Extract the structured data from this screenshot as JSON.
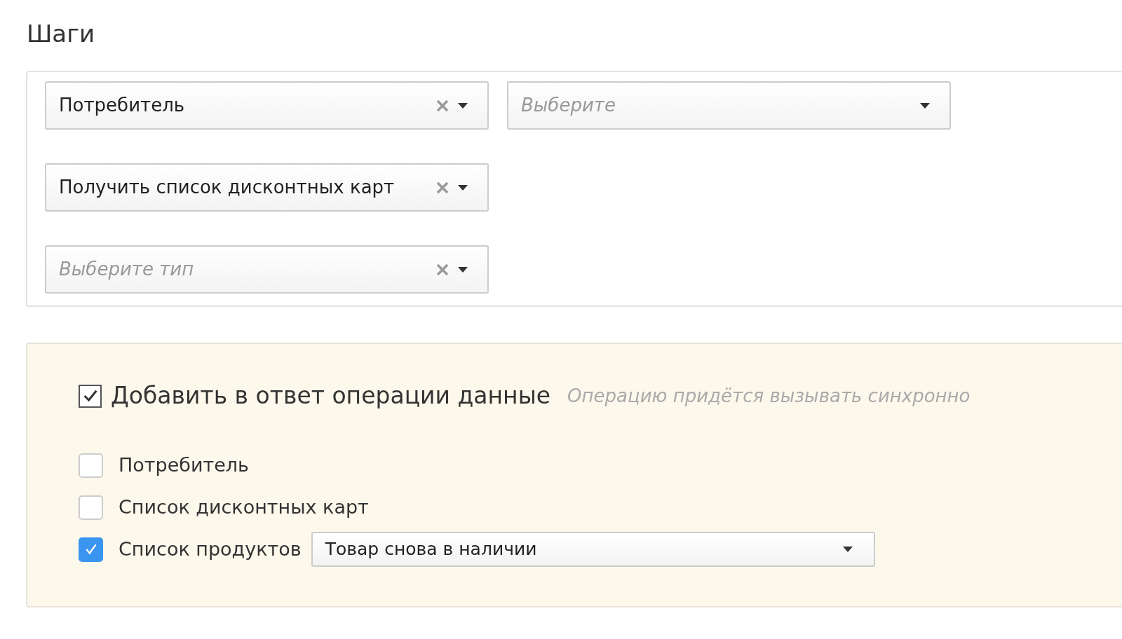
{
  "title": "Шаги",
  "steps": [
    {
      "selects": [
        {
          "value": "Потребитель",
          "clearable": true
        },
        {
          "placeholder": "Выберите",
          "clearable": false
        }
      ]
    },
    {
      "selects": [
        {
          "value": "Получить список дисконтных карт",
          "clearable": true
        }
      ]
    },
    {
      "selects": [
        {
          "placeholder": "Выберите тип",
          "clearable": true
        }
      ]
    }
  ],
  "response": {
    "label": "Добавить в ответ операции данные",
    "checked": true,
    "hint": "Операцию придётся вызывать синхронно",
    "items": [
      {
        "label": "Потребитель",
        "checked": false
      },
      {
        "label": "Список дисконтных карт",
        "checked": false
      },
      {
        "label": "Список продуктов",
        "checked": true,
        "select": {
          "value": "Товар снова в наличии"
        }
      }
    ]
  }
}
